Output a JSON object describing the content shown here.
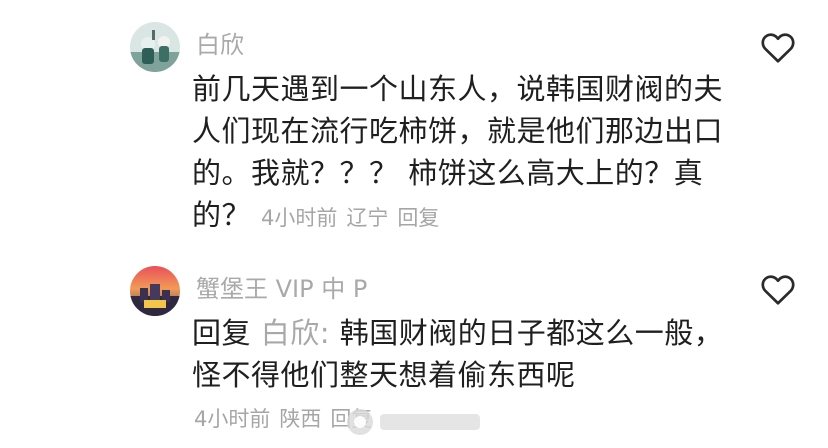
{
  "comments": [
    {
      "username": "白欣",
      "lines": [
        "前几天遇到一个山东人，说韩国财阀的夫",
        "人们现在流行吃柿饼，就是他们那边出口",
        "的。我就？？？ 柿饼这么高大上的？真",
        "的？"
      ],
      "time": "4小时前",
      "location": "辽宁",
      "reply_label": "回复"
    },
    {
      "username": "蟹堡王 VIP 中 P",
      "reply_prefix": "回复",
      "reply_to": "白欣:",
      "lines": [
        " 韩国财阀的日子都这么一般，",
        "怪不得他们整天想着偷东西呢"
      ],
      "time": "4小时前",
      "location": "陕西",
      "reply_label": "回复"
    }
  ],
  "icons": {
    "like": "heart-outline-icon"
  },
  "colors": {
    "username": "#a9a9a9",
    "text": "#1f1f1f",
    "meta": "#a6a6a6"
  }
}
